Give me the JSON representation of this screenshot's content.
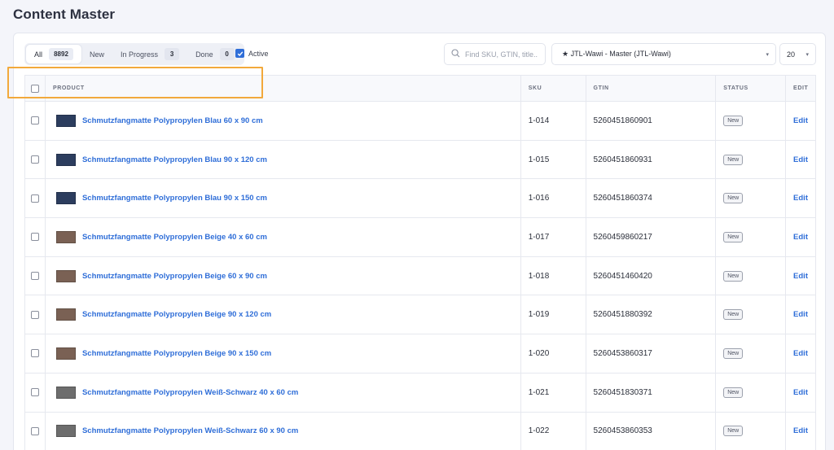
{
  "page": {
    "title": "Content Master"
  },
  "tabs": [
    {
      "label": "All",
      "count": "8892"
    },
    {
      "label": "New",
      "count": ""
    },
    {
      "label": "In Progress",
      "count": "3"
    },
    {
      "label": "Done",
      "count": "0"
    }
  ],
  "filters": {
    "active_label": "Active",
    "active_checked": true,
    "search_placeholder": "Find SKU, GTIN, title..",
    "channel": "★ JTL-Wawi - Master (JTL-Wawi)",
    "page_size": "20"
  },
  "table": {
    "columns": {
      "product": "PRODUCT",
      "sku": "SKU",
      "gtin": "GTIN",
      "status": "STATUS",
      "edit": "EDIT"
    },
    "rows": [
      {
        "product": "Schmutzfangmatte Polypropylen Blau 60 x 90 cm",
        "sku": "1-014",
        "gtin": "5260451860901",
        "status": "New",
        "edit": "Edit",
        "thumb": "blau"
      },
      {
        "product": "Schmutzfangmatte Polypropylen Blau 90 x 120 cm",
        "sku": "1-015",
        "gtin": "5260451860931",
        "status": "New",
        "edit": "Edit",
        "thumb": "blau"
      },
      {
        "product": "Schmutzfangmatte Polypropylen Blau 90 x 150 cm",
        "sku": "1-016",
        "gtin": "5260451860374",
        "status": "New",
        "edit": "Edit",
        "thumb": "blau"
      },
      {
        "product": "Schmutzfangmatte Polypropylen Beige 40 x 60 cm",
        "sku": "1-017",
        "gtin": "5260459860217",
        "status": "New",
        "edit": "Edit",
        "thumb": "beige"
      },
      {
        "product": "Schmutzfangmatte Polypropylen Beige 60 x 90 cm",
        "sku": "1-018",
        "gtin": "5260451460420",
        "status": "New",
        "edit": "Edit",
        "thumb": "beige"
      },
      {
        "product": "Schmutzfangmatte Polypropylen Beige 90 x 120 cm",
        "sku": "1-019",
        "gtin": "5260451880392",
        "status": "New",
        "edit": "Edit",
        "thumb": "beige"
      },
      {
        "product": "Schmutzfangmatte Polypropylen Beige 90 x 150 cm",
        "sku": "1-020",
        "gtin": "5260453860317",
        "status": "New",
        "edit": "Edit",
        "thumb": "beige"
      },
      {
        "product": "Schmutzfangmatte Polypropylen Weiß-Schwarz 40 x 60 cm",
        "sku": "1-021",
        "gtin": "5260451830371",
        "status": "New",
        "edit": "Edit",
        "thumb": "weiss"
      },
      {
        "product": "Schmutzfangmatte Polypropylen Weiß-Schwarz 60 x 90 cm",
        "sku": "1-022",
        "gtin": "5260453860353",
        "status": "New",
        "edit": "Edit",
        "thumb": "weiss"
      }
    ]
  },
  "colors": {
    "accent": "#2f6ed8",
    "highlight": "#f2a93b"
  }
}
